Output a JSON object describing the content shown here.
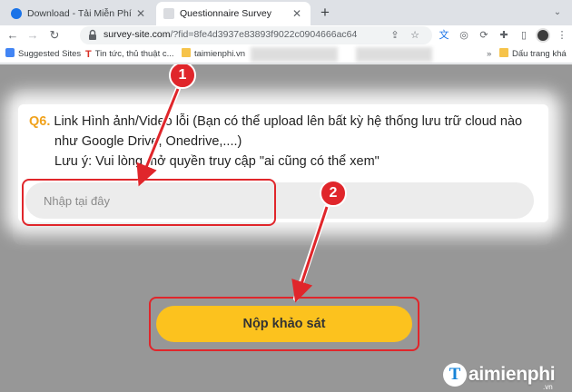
{
  "browser": {
    "tabs": [
      {
        "title": "Download - Tải Miễn Phí VN - Ph",
        "active": false
      },
      {
        "title": "Questionnaire Survey",
        "active": true
      }
    ],
    "new_tab_symbol": "+",
    "address_host": "survey-site.com",
    "address_path": "/?fid=8fe4d3937e83893f9022c0904666ac64",
    "bookmarks": [
      {
        "label": "Suggested Sites",
        "icon": "apps-icon"
      },
      {
        "label": "Tin tức, thủ thuật c...",
        "icon": "bookmark-favicon-icon"
      },
      {
        "label": "taimienphi.vn",
        "icon": "folder-icon"
      },
      {
        "label": "Dấu trang khá",
        "icon": "folder-icon"
      }
    ]
  },
  "question": {
    "number": "Q6.",
    "line1": "Link Hình ảnh/Video lỗi (Bạn có thể upload lên bất kỳ hệ thống lưu trữ cloud nào",
    "line2": "như Google Drive, Onedrive,....)",
    "line3": "Lưu ý: Vui lòng mở quyền truy cập \"ai cũng có thể xem\"",
    "answer_placeholder": "Nhập tại đây"
  },
  "submit": {
    "label": "Nộp khảo sát"
  },
  "annotations": {
    "step1": "1",
    "step2": "2",
    "highlight_color": "#e0262b"
  },
  "watermark": {
    "letter": "T",
    "name": "aimienphi",
    "suffix": ".vn"
  },
  "colors": {
    "accent": "#fcc21e",
    "question_number": "#f0a21c",
    "overlay": "#979797"
  }
}
